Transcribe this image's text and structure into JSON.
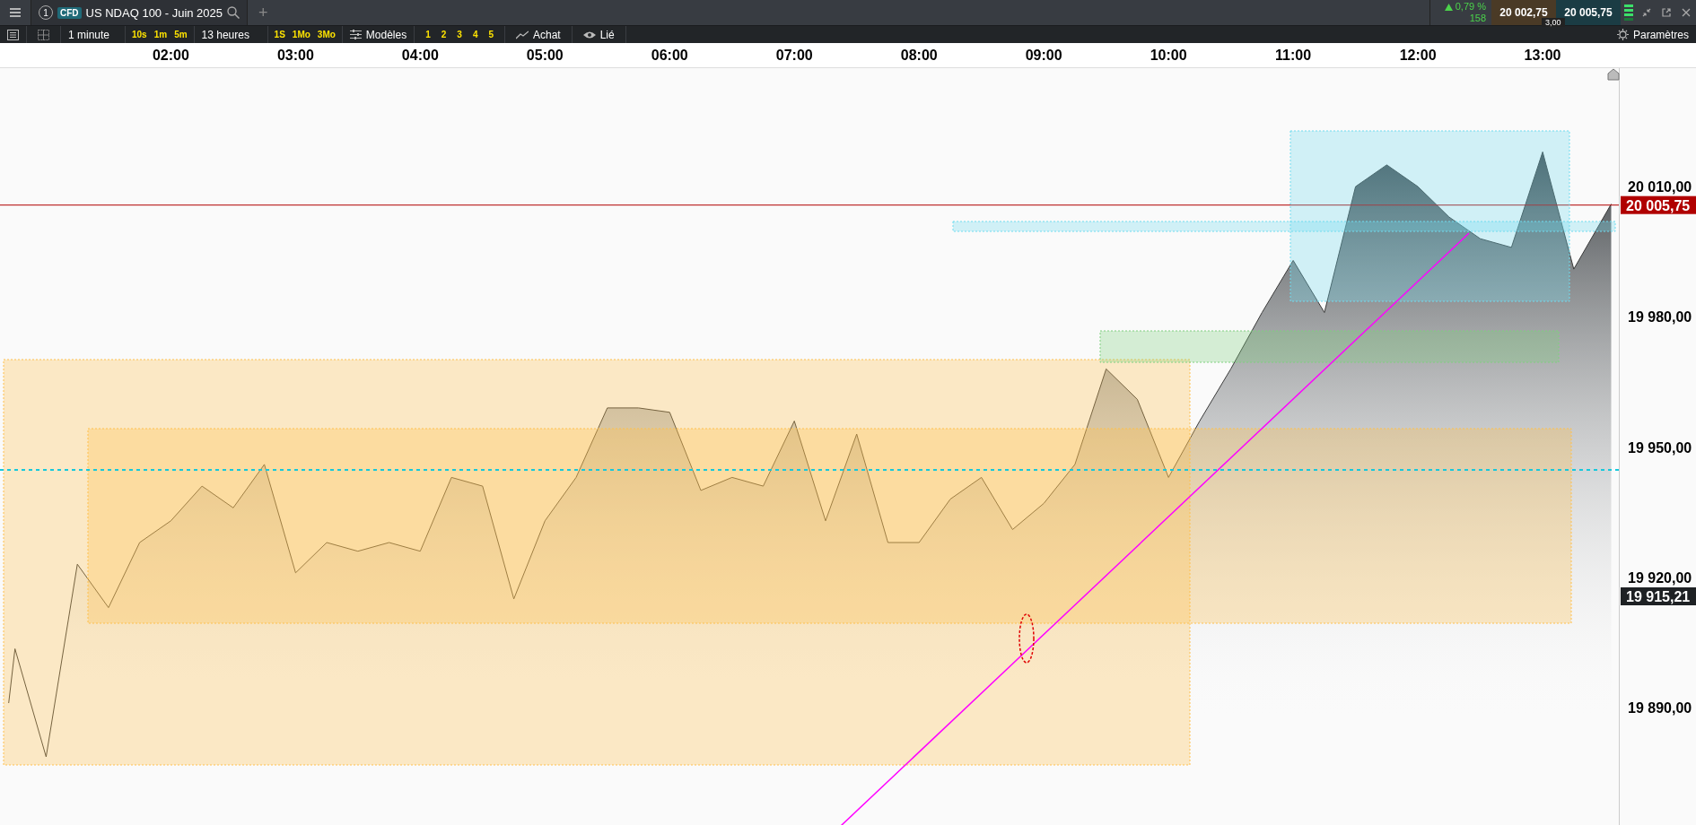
{
  "toolbar": {
    "tab": {
      "number": "1",
      "badge": "CFD",
      "title": "US NDAQ 100 - Juin 2025"
    },
    "add": "+",
    "quote": {
      "change": "0,79 %",
      "points": "158",
      "bid": "20 002,75",
      "ask": "20 005,75",
      "spread": "3,00"
    }
  },
  "controls": {
    "interval": "1 minute",
    "interval_presets": [
      "10s",
      "1m",
      "5m"
    ],
    "range": "13 heures",
    "range_presets": [
      "1S",
      "1Mo",
      "3Mo"
    ],
    "templates": "Modèles",
    "slots": [
      "1",
      "2",
      "3",
      "4",
      "5"
    ],
    "buy": "Achat",
    "linked": "Lié",
    "settings": "Paramètres"
  },
  "chart": {
    "chart_data": {
      "type": "area",
      "x": [
        0.7,
        0.75,
        1,
        1.25,
        1.5,
        1.75,
        2,
        2.25,
        2.5,
        2.75,
        3,
        3.25,
        3.5,
        3.75,
        4,
        4.25,
        4.5,
        4.75,
        5,
        5.25,
        5.5,
        5.75,
        6,
        6.25,
        6.5,
        6.75,
        7,
        7.25,
        7.5,
        7.75,
        8,
        8.25,
        8.5,
        8.75,
        9,
        9.25,
        9.5,
        9.75,
        10,
        10.25,
        10.5,
        10.75,
        11,
        11.25,
        11.5,
        11.75,
        12,
        12.25,
        12.5,
        12.75,
        13,
        13.25,
        13.55
      ],
      "series": [
        {
          "color": "#3a3a3a",
          "values": [
            19891,
            19903.5,
            19878.6,
            19923,
            19913,
            19928,
            19933,
            19941,
            19936,
            19946,
            19921,
            19928,
            19926,
            19928,
            19926,
            19943,
            19941,
            19915,
            19933,
            19943,
            19959,
            19959,
            19958,
            19940,
            19943,
            19941,
            19956,
            19933,
            19953,
            19928,
            19928,
            19938,
            19943,
            19931,
            19937,
            19946,
            19968,
            19961,
            19943,
            19956,
            19968,
            19981,
            19993,
            19981,
            20010,
            20015,
            20010,
            20003,
            19998,
            19996,
            20018,
            19991,
            20006
          ]
        }
      ],
      "xlim": [
        0.63,
        14.23
      ],
      "ylim": [
        19862.7,
        20037.3
      ],
      "xticks": [
        {
          "value": 2,
          "label": "02:00"
        },
        {
          "value": 3,
          "label": "03:00"
        },
        {
          "value": 4,
          "label": "04:00"
        },
        {
          "value": 5,
          "label": "05:00"
        },
        {
          "value": 6,
          "label": "06:00"
        },
        {
          "value": 7,
          "label": "07:00"
        },
        {
          "value": 8,
          "label": "08:00"
        },
        {
          "value": 9,
          "label": "09:00"
        },
        {
          "value": 10,
          "label": "10:00"
        },
        {
          "value": 11,
          "label": "11:00"
        },
        {
          "value": 12,
          "label": "12:00"
        },
        {
          "value": 13,
          "label": "13:00"
        }
      ],
      "yticks": [
        {
          "value": 20010,
          "label": "20 010,00"
        },
        {
          "value": 19980,
          "label": "19 980,00"
        },
        {
          "value": 19950,
          "label": "19 950,00"
        },
        {
          "value": 19920,
          "label": "19 920,00"
        },
        {
          "value": 19890,
          "label": "19 890,00"
        }
      ],
      "ref_lines": [
        {
          "axis": "y",
          "value": 20005.75,
          "label": "20 005,75",
          "color": "#b00000"
        }
      ]
    },
    "cursor_badge": "19 915,21"
  }
}
